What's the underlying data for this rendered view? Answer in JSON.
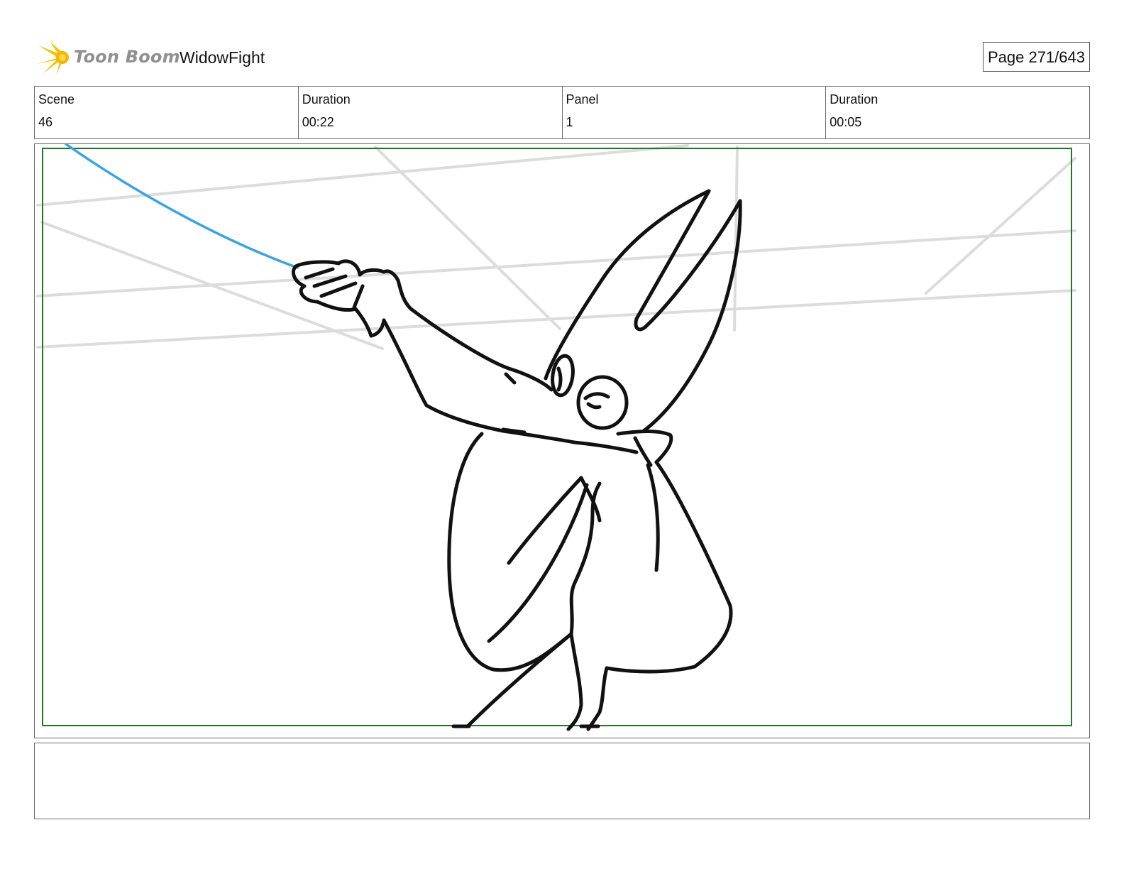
{
  "header": {
    "logo_text": "Toon Boom",
    "project_title": "WidowFight",
    "page": "Page 271/643"
  },
  "info": {
    "scene_label": "Scene",
    "scene_value": "46",
    "scene_duration_label": "Duration",
    "scene_duration_value": "00:22",
    "panel_label": "Panel",
    "panel_value": "1",
    "panel_duration_label": "Duration",
    "panel_duration_value": "00:05"
  },
  "panel": {
    "safe_frame_color": "#1e7a1e",
    "web_line_color": "#3aa3e3",
    "sketch_color": "#111111",
    "background_line_color": "#dcdcdc"
  },
  "notes": {
    "text": ""
  }
}
